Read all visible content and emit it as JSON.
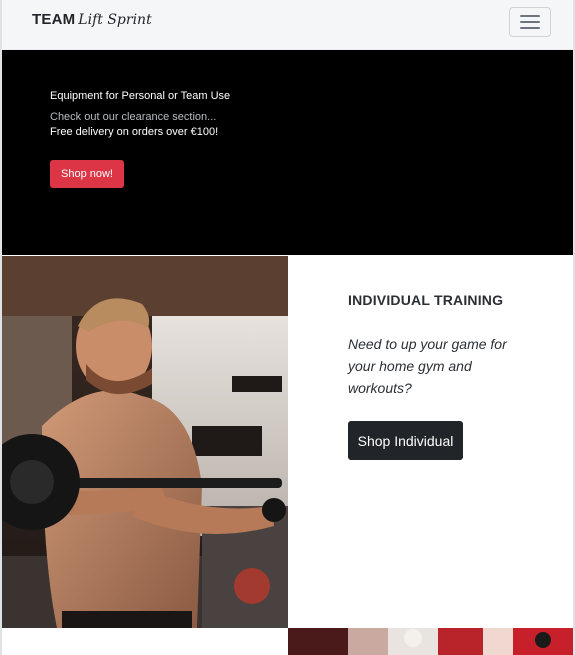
{
  "navbar": {
    "brand_strong": "TEAM",
    "brand_script": "Lift Sprint",
    "toggler_icon": "hamburger-icon"
  },
  "hero": {
    "title": "Equipment for Personal or Team Use",
    "subtitle": "Check out our clearance section...",
    "delivery": "Free delivery on orders over €100!",
    "button_label": "Shop now!"
  },
  "individual": {
    "heading": "INDIVIDUAL TRAINING",
    "text": "Need to up your game for your home gym and workouts?",
    "button_label": "Shop Individual"
  },
  "colors": {
    "navbar_bg": "#f5f6f8",
    "hero_bg": "#000000",
    "accent_red": "#dc3545",
    "dark_button": "#212529"
  }
}
